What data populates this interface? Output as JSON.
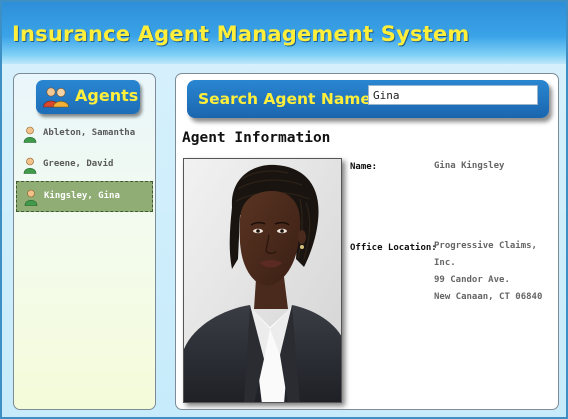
{
  "app": {
    "title": "Insurance Agent Management System"
  },
  "sidebar": {
    "header_label": "Agents",
    "header_icon": "agents-group-icon",
    "items": [
      {
        "label": "Ableton, Samantha",
        "icon": "person-icon",
        "selected": false
      },
      {
        "label": "Greene, David",
        "icon": "person-icon",
        "selected": false
      },
      {
        "label": "Kingsley, Gina",
        "icon": "person-icon",
        "selected": true
      }
    ]
  },
  "search": {
    "label": "Search Agent Name",
    "value": "Gina"
  },
  "agent_info": {
    "section_title": "Agent Information",
    "photo": "agent-photo",
    "name_label": "Name:",
    "name_value": "Gina Kingsley",
    "office_label": "Office Location:",
    "office_lines": [
      "Progressive Claims, Inc.",
      "99 Candor Ave.",
      "New Canaan, CT 06840"
    ]
  },
  "colors": {
    "title_text": "#ffee3a",
    "header_blue": "#1d6db7",
    "selected_row": "#90ad75"
  }
}
